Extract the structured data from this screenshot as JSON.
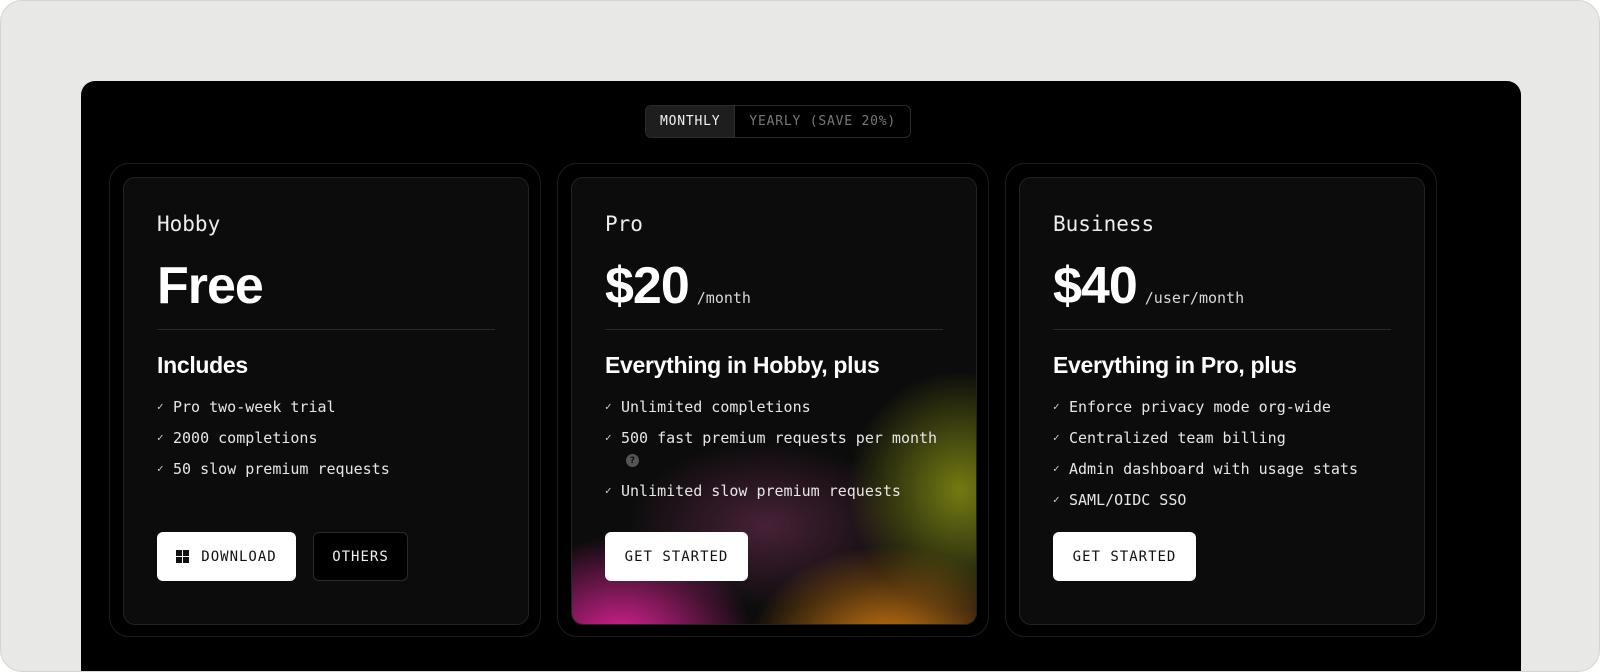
{
  "billing_toggle": {
    "monthly_label": "MONTHLY",
    "yearly_label": "YEARLY (SAVE 20%)",
    "selected": "MONTHLY"
  },
  "plans": [
    {
      "name": "Hobby",
      "price": "Free",
      "period": "",
      "includes_title": "Includes",
      "features": [
        "Pro two-week trial",
        "2000 completions",
        "50 slow premium requests"
      ],
      "primary_button": "DOWNLOAD",
      "secondary_button": "OTHERS",
      "primary_icon": "windows-icon"
    },
    {
      "name": "Pro",
      "price": "$20",
      "period": "/month",
      "includes_title": "Everything in Hobby, plus",
      "features": [
        "Unlimited completions",
        "500 fast premium requests per month",
        "Unlimited slow premium requests"
      ],
      "info_icon_glyph": "?",
      "primary_button": "GET STARTED"
    },
    {
      "name": "Business",
      "price": "$40",
      "period": "/user/month",
      "includes_title": "Everything in Pro, plus",
      "features": [
        "Enforce privacy mode org-wide",
        "Centralized team billing",
        "Admin dashboard with usage stats",
        "SAML/OIDC SSO"
      ],
      "primary_button": "GET STARTED"
    }
  ],
  "colors": {
    "page_background": "#e8e8e6",
    "panel_background": "#000000",
    "card_background": "#0c0c0c",
    "accent_pink": "#ec24a0",
    "accent_orange": "#e28412",
    "accent_olive": "#96a014"
  },
  "icons": {
    "check": "✓"
  }
}
